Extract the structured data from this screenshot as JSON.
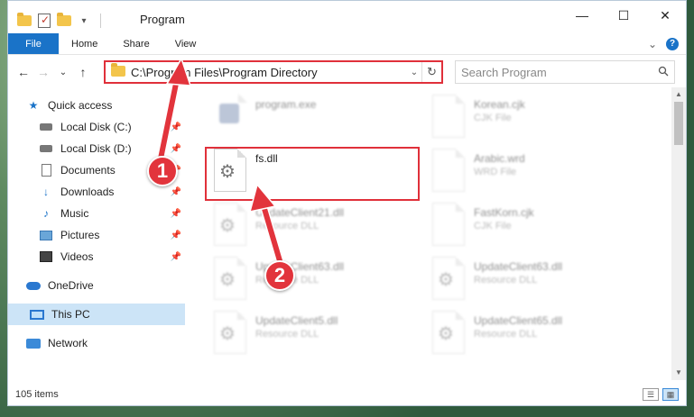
{
  "window": {
    "title": "Program",
    "minimize": "—",
    "maximize": "☐",
    "close": "✕"
  },
  "ribbon": {
    "tabs": [
      "File",
      "Home",
      "Share",
      "View"
    ],
    "expand": "⌄",
    "help": "?"
  },
  "address": {
    "back": "←",
    "forward": "→",
    "recent": "⌄",
    "up": "↑",
    "path": "C:\\Program Files\\Program Directory",
    "dropdown": "⌄",
    "refresh": "↻"
  },
  "search": {
    "placeholder": "Search Program",
    "icon": "search-icon"
  },
  "sidebar": {
    "items": [
      {
        "label": "Quick access",
        "icon": "star-icon"
      },
      {
        "label": "Local Disk (C:)",
        "icon": "disk-icon",
        "pinned": true
      },
      {
        "label": "Local Disk (D:)",
        "icon": "disk-icon",
        "pinned": true
      },
      {
        "label": "Documents",
        "icon": "document-icon",
        "pinned": true
      },
      {
        "label": "Downloads",
        "icon": "download-icon",
        "pinned": true
      },
      {
        "label": "Music",
        "icon": "music-icon",
        "pinned": true
      },
      {
        "label": "Pictures",
        "icon": "pictures-icon",
        "pinned": true
      },
      {
        "label": "Videos",
        "icon": "videos-icon",
        "pinned": true
      },
      {
        "label": "OneDrive",
        "icon": "cloud-icon"
      },
      {
        "label": "This PC",
        "icon": "computer-icon",
        "selected": true
      },
      {
        "label": "Network",
        "icon": "network-icon"
      }
    ]
  },
  "files": [
    {
      "name": "program.exe",
      "type": "",
      "icon": "exe-icon"
    },
    {
      "name": "Korean.cjk",
      "type": "CJK File",
      "icon": "file-icon"
    },
    {
      "name": "fs.dll",
      "type": "",
      "icon": "dll-icon"
    },
    {
      "name": "Arabic.wrd",
      "type": "WRD File",
      "icon": "file-icon"
    },
    {
      "name": "UpdateClient21.dll",
      "type": "Resource DLL",
      "icon": "dll-icon"
    },
    {
      "name": "FastKorn.cjk",
      "type": "CJK File",
      "icon": "file-icon"
    },
    {
      "name": "UpdateClient63.dll",
      "type": "Resource DLL",
      "icon": "dll-icon"
    },
    {
      "name": "UpdateClient63.dll",
      "type": "Resource DLL",
      "icon": "dll-icon"
    },
    {
      "name": "UpdateClient5.dll",
      "type": "Resource DLL",
      "icon": "dll-icon"
    },
    {
      "name": "UpdateClient65.dll",
      "type": "Resource DLL",
      "icon": "dll-icon"
    }
  ],
  "status": {
    "count": "105 items"
  },
  "annotations": {
    "step1": "1",
    "step2": "2"
  },
  "colors": {
    "accent": "#1a73c8",
    "highlight": "#e0303a",
    "selected": "#cce4f7"
  }
}
